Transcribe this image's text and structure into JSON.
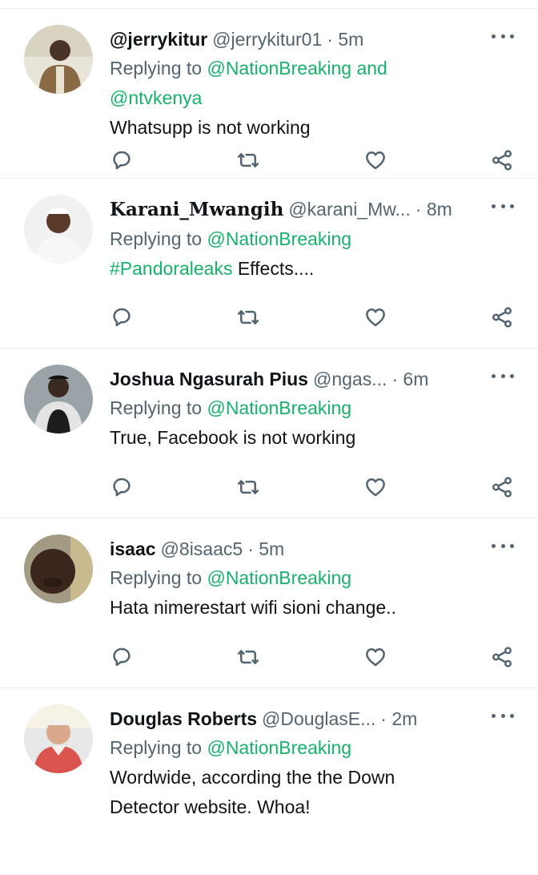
{
  "colors": {
    "accent": "#17b26a",
    "muted": "#536471",
    "text": "#0f1419"
  },
  "icons": {
    "more": "more-dots-icon",
    "reply": "reply-icon",
    "retweet": "retweet-icon",
    "like": "heart-icon",
    "share": "share-icon"
  },
  "tweets": [
    {
      "name": "@jerrykitur",
      "handle": "@jerrykitur01",
      "time": "· 5m",
      "replying_prefix": "Replying to",
      "replying_to": "@NationBreaking and @ntvkenya",
      "hashtag": "",
      "text": "Whatsupp is not working"
    },
    {
      "name": "Karani_Mwangih",
      "handle": "@karani_Mw...",
      "time": "· 8m",
      "replying_prefix": "Replying to",
      "replying_to": "@NationBreaking",
      "hashtag": "#Pandoraleaks",
      "text": "Effects...."
    },
    {
      "name": "Joshua Ngasurah Pius",
      "handle": "@ngas...",
      "time": "· 6m",
      "replying_prefix": "Replying to",
      "replying_to": "@NationBreaking",
      "hashtag": "",
      "text": "True, Facebook is not working"
    },
    {
      "name": "isaac",
      "handle": "@8isaac5",
      "time": "· 5m",
      "replying_prefix": "Replying to",
      "replying_to": "@NationBreaking",
      "hashtag": "",
      "text": "Hata nimerestart wifi sioni change.."
    },
    {
      "name": "Douglas Roberts",
      "handle": "@DouglasE...",
      "time": "· 2m",
      "replying_prefix": "Replying to",
      "replying_to": "@NationBreaking",
      "hashtag": "",
      "text": "Wordwide, according the the Down Detector website.  Whoa!"
    }
  ]
}
